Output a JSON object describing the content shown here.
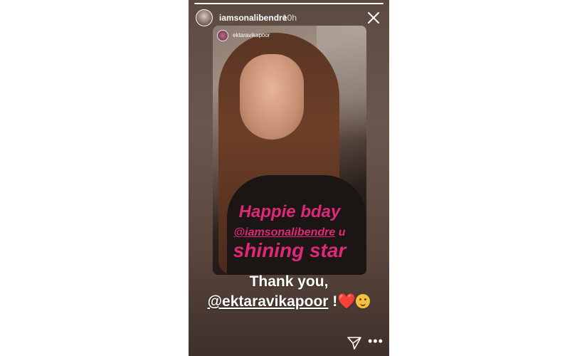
{
  "story": {
    "progress": 1.0,
    "username": "iamsonalibendre",
    "time": "10h",
    "close_icon": "close-icon"
  },
  "reshared_post": {
    "username": "ektaravikapoor",
    "line1": "Happie bday",
    "mention": "@iamsonalibendre",
    "mention_suffix": " u",
    "line3": "shining star"
  },
  "caption": {
    "line1": "Thank you,",
    "mention": "@ektaravikapoor",
    "suffix": " !",
    "heart": "❤️",
    "hug_icon": "hugging-face-emoji"
  },
  "footer": {
    "send_icon": "send-icon",
    "more_icon": "more-options-icon",
    "more_label": "•••"
  },
  "colors": {
    "greeting_pink": "#e0287a",
    "text_white": "#ffffff",
    "story_bg": "#5c4a41"
  }
}
